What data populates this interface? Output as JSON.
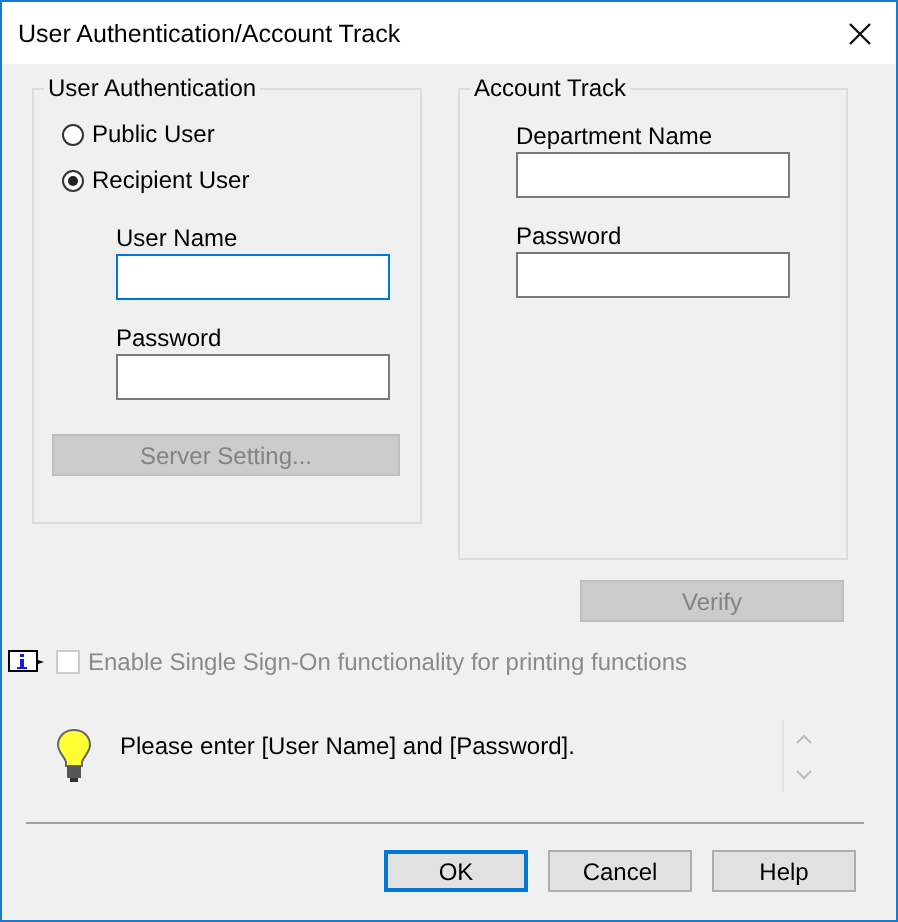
{
  "window": {
    "title": "User Authentication/Account Track"
  },
  "user_authentication": {
    "title": "User Authentication",
    "options": [
      {
        "label": "Public User",
        "selected": false
      },
      {
        "label": "Recipient User",
        "selected": true
      }
    ],
    "fields": [
      {
        "label": "User Name",
        "focused": true
      },
      {
        "label": "Password",
        "focused": false
      }
    ],
    "button": {
      "label": "Server Setting...",
      "disabled": true
    }
  },
  "account_track": {
    "title": "Account Track",
    "fields": [
      {
        "label": "Department Name",
        "focused": false
      },
      {
        "label": "Password",
        "focused": false
      }
    ]
  },
  "verify_button": {
    "label": "Verify",
    "disabled": true
  },
  "single_sign_on": {
    "label": "Enable Single Sign-On functionality for printing functions",
    "checked": false,
    "disabled": true
  },
  "message": "Please enter [User Name] and [Password].",
  "buttons": [
    {
      "label": "OK",
      "default": true
    },
    {
      "label": "Cancel",
      "default": false
    },
    {
      "label": "Help",
      "default": false
    }
  ]
}
